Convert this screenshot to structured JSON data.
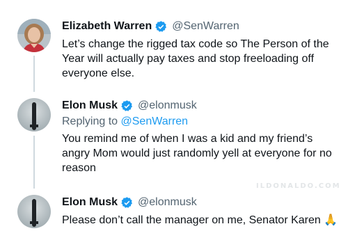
{
  "tweets": [
    {
      "name": "Elizabeth Warren",
      "handle": "@SenWarren",
      "reply_label": "",
      "reply_to": "",
      "text": "Let’s change the rigged tax code so The Person of the Year will actually pay taxes and stop freeloading off everyone else.",
      "avatar_icon": "person-photo-avatar"
    },
    {
      "name": "Elon Musk",
      "handle": "@elonmusk",
      "reply_label": "Replying to",
      "reply_to": "@SenWarren",
      "text": "You remind me of when I was a kid and my friend’s angry Mom would just randomly yell at everyone for no reason",
      "avatar_icon": "rocket-photo-avatar"
    },
    {
      "name": "Elon Musk",
      "handle": "@elonmusk",
      "reply_label": "",
      "reply_to": "",
      "text": "Please don’t call the manager on me, Senator Karen 🙏",
      "avatar_icon": "rocket-photo-avatar"
    }
  ],
  "watermark": "ILDONALDO.COM",
  "colors": {
    "verified": "#1d9bf0",
    "thread_line": "#cfd9de",
    "handle": "#536471",
    "mention": "#1d9bf0"
  }
}
